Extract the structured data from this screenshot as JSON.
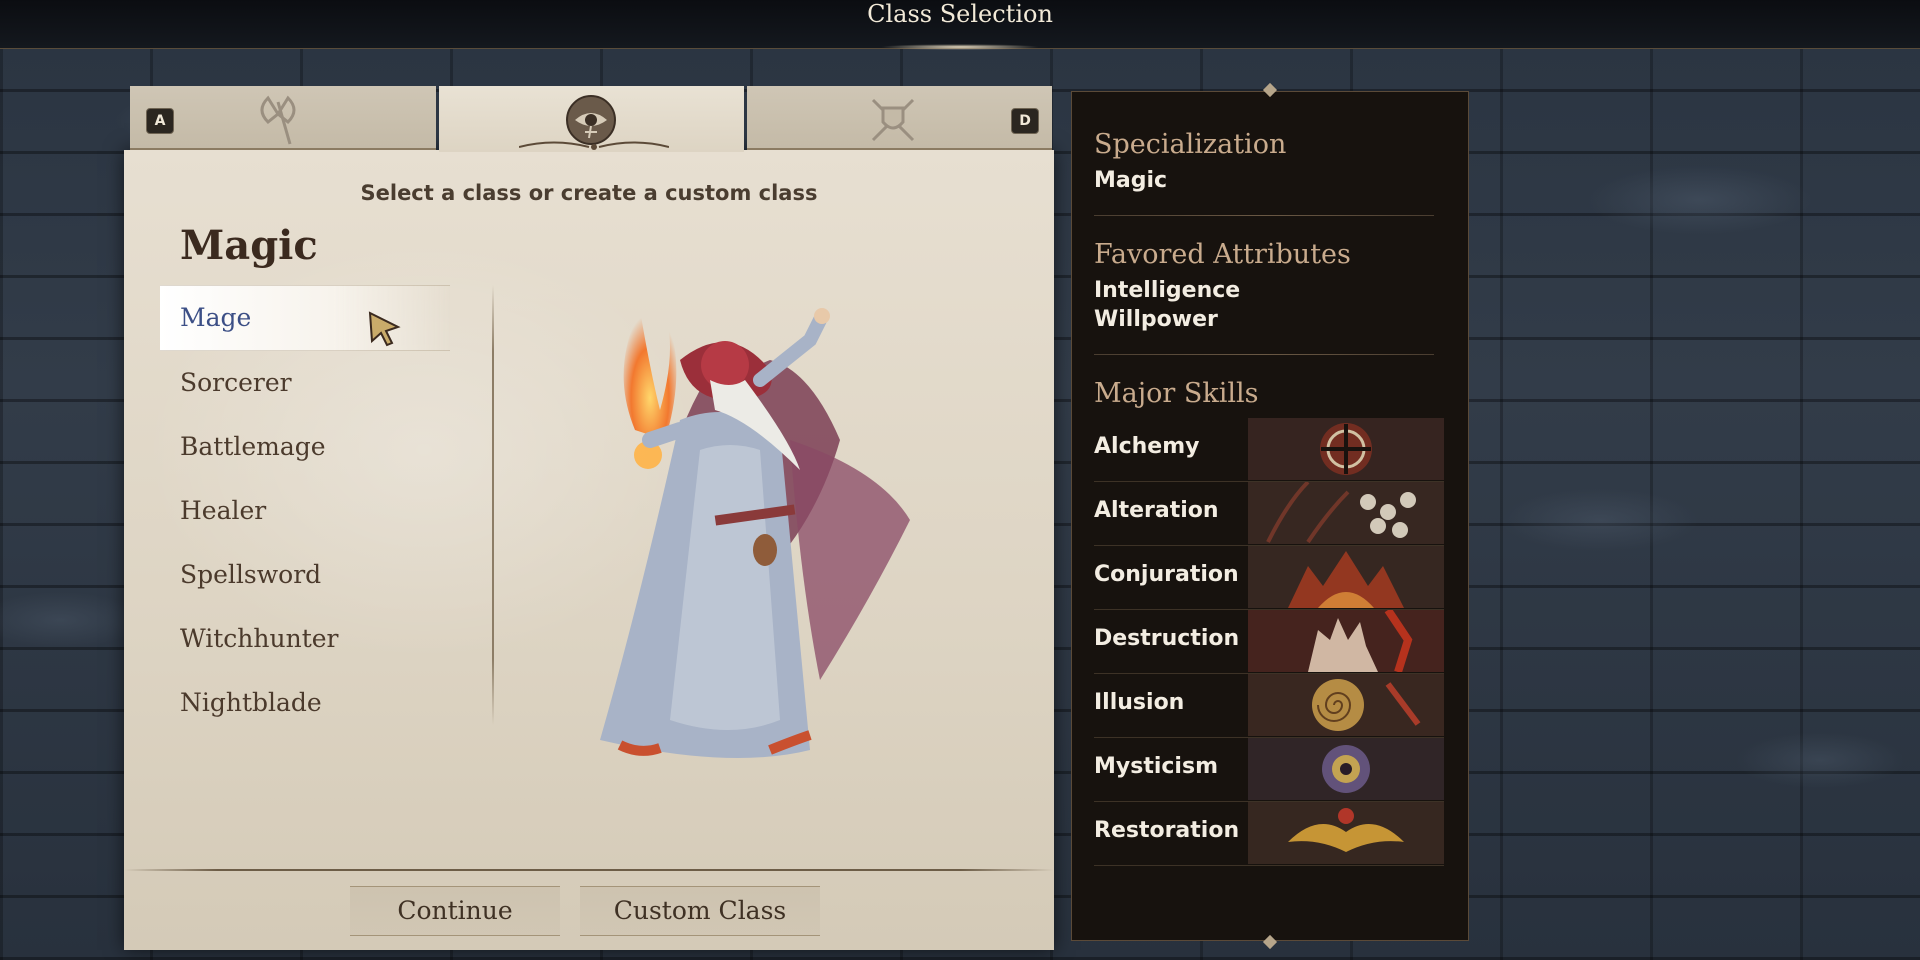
{
  "header": {
    "title": "Class Selection"
  },
  "tabs": [
    {
      "key": "A",
      "icon": "axe-icon",
      "active": false
    },
    {
      "key": "",
      "icon": "eye-of-magic-icon",
      "active": true
    },
    {
      "key": "D",
      "icon": "crossed-swords-shield-icon",
      "active": false
    }
  ],
  "main": {
    "subtitle": "Select a class or create a custom class",
    "group_title": "Magic",
    "classes": [
      "Mage",
      "Sorcerer",
      "Battlemage",
      "Healer",
      "Spellsword",
      "Witchhunter",
      "Nightblade"
    ],
    "selected_class": "Mage"
  },
  "buttons": {
    "continue": "Continue",
    "custom_class": "Custom Class"
  },
  "info": {
    "specialization_heading": "Specialization",
    "specialization": "Magic",
    "attributes_heading": "Favored Attributes",
    "attributes": [
      "Intelligence",
      "Willpower"
    ],
    "skills_heading": "Major Skills",
    "skills": [
      "Alchemy",
      "Alteration",
      "Conjuration",
      "Destruction",
      "Illusion",
      "Mysticism",
      "Restoration"
    ]
  },
  "colors": {
    "parchment": "#ddd4c3",
    "panel": "#17120e",
    "heading": "#c9ab8d",
    "selected": "#3c4f86"
  }
}
